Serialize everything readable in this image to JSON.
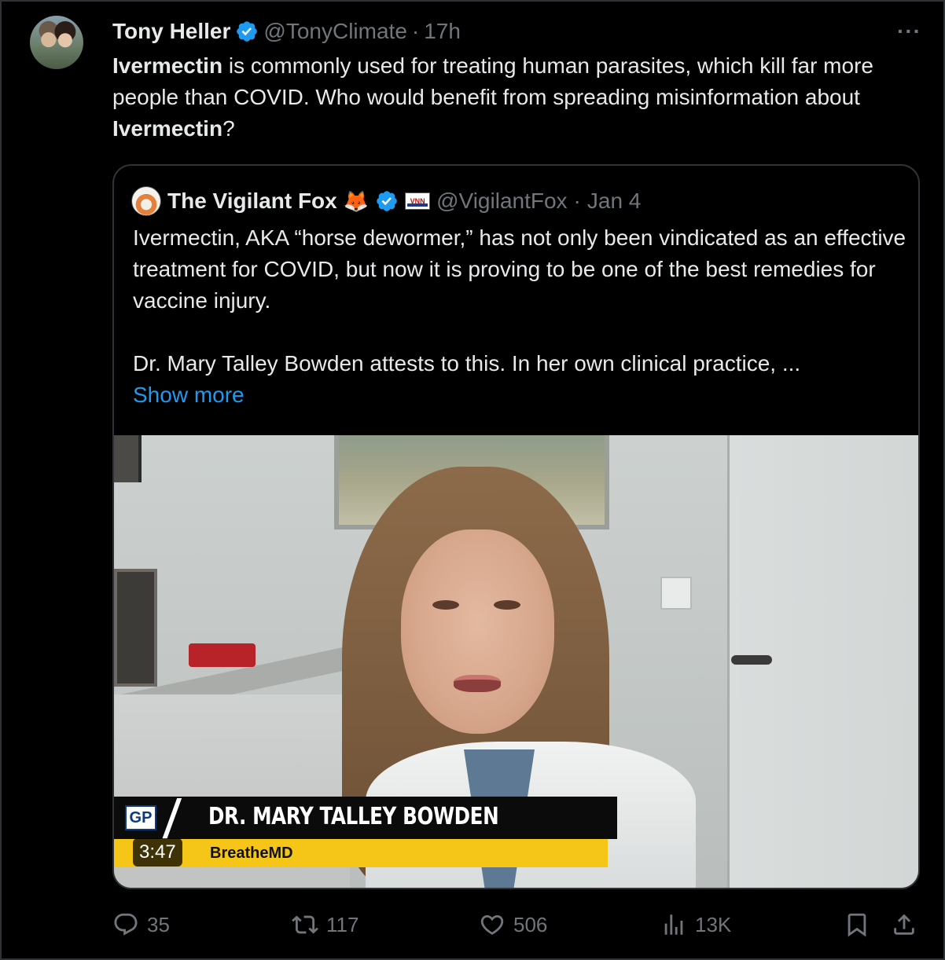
{
  "tweet": {
    "author_name": "Tony Heller",
    "handle": "@TonyClimate",
    "separator": "·",
    "time": "17h",
    "more_label": "···",
    "text_parts": [
      {
        "bold": true,
        "text": "Ivermectin"
      },
      {
        "bold": false,
        "text": " is commonly used for treating human parasites, which kill far more people than COVID.  Who would benefit from spreading misinformation about "
      },
      {
        "bold": true,
        "text": "Ivermectin"
      },
      {
        "bold": false,
        "text": "?"
      }
    ]
  },
  "quote": {
    "author_name": "The Vigilant Fox",
    "emoji": "🦊",
    "badge_label": "VNN",
    "handle": "@VigilantFox",
    "separator": "·",
    "date": "Jan 4",
    "paragraph_1": "Ivermectin, AKA “horse dewormer,” has not only been vindicated as an effective treatment for COVID, but now it is proving to be one of the best remedies for vaccine injury.",
    "paragraph_2": "Dr. Mary Talley Bowden attests to this. In her own clinical practice, ...",
    "show_more": "Show more"
  },
  "video": {
    "logo": "GP",
    "lower_third_name": "DR. MARY TALLEY BOWDEN",
    "lower_third_org": "BreatheMD",
    "duration": "3:47"
  },
  "actions": {
    "replies": "35",
    "reposts": "117",
    "likes": "506",
    "views": "13K"
  },
  "colors": {
    "background": "#000000",
    "text": "#e7e9ea",
    "muted": "#71767b",
    "border": "#2f3336",
    "link": "#1d9bf0",
    "verified": "#1d9bf0",
    "lower_third_yellow": "#f5c518"
  },
  "icons": {
    "verified": "verified-badge-icon",
    "reply": "speech-bubble-icon",
    "repost": "repost-arrows-icon",
    "like": "heart-icon",
    "views": "bar-chart-icon",
    "bookmark": "bookmark-icon",
    "share": "share-upload-icon"
  }
}
